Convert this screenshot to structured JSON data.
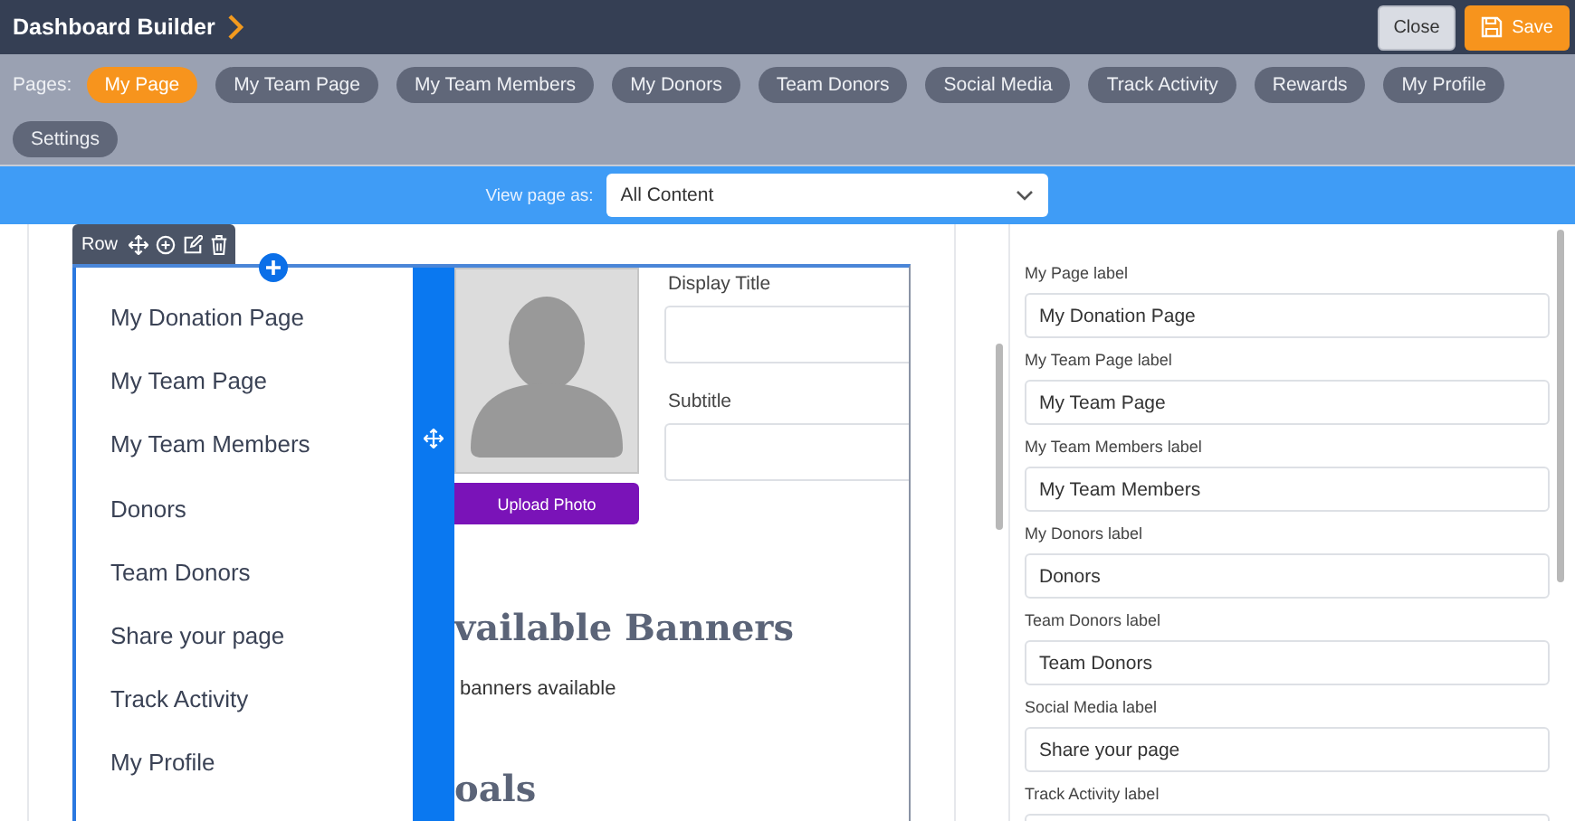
{
  "header": {
    "title": "Dashboard Builder",
    "buttons": [
      {
        "label": "Close",
        "kind": "plain"
      },
      {
        "label": "Save",
        "kind": "save"
      }
    ]
  },
  "pages": {
    "label": "Pages:",
    "items": [
      {
        "label": "My Page",
        "selected": true
      },
      {
        "label": "My Team Page",
        "selected": false
      },
      {
        "label": "My Team Members",
        "selected": false
      },
      {
        "label": "My Donors",
        "selected": false
      },
      {
        "label": "Team Donors",
        "selected": false
      },
      {
        "label": "Social Media",
        "selected": false
      },
      {
        "label": "Track Activity",
        "selected": false
      },
      {
        "label": "Rewards",
        "selected": false
      },
      {
        "label": "My Profile",
        "selected": false
      },
      {
        "label": "Settings",
        "selected": false
      }
    ]
  },
  "view_bar": {
    "label": "View page as:",
    "value": "All Content"
  },
  "canvas": {
    "row_toolbar": {
      "label": "Row"
    },
    "menu_items": [
      "My Donation Page",
      "My Team Page",
      "My Team Members",
      "Donors",
      "Team Donors",
      "Share your page",
      "Track Activity",
      "My Profile"
    ],
    "upload_button": "Upload Photo",
    "fields": [
      {
        "label": "Display Title"
      },
      {
        "label": "Subtitle"
      }
    ],
    "banners_heading": "vailable Banners",
    "banners_text": "banners available",
    "goals_heading": "oals"
  },
  "settings_panel": {
    "fields": [
      {
        "label": "My Page label",
        "value": "My Donation Page"
      },
      {
        "label": "My Team Page label",
        "value": "My Team Page"
      },
      {
        "label": "My Team Members label",
        "value": "My Team Members"
      },
      {
        "label": "My Donors label",
        "value": "Donors"
      },
      {
        "label": "Team Donors label",
        "value": "Team Donors"
      },
      {
        "label": "Social Media label",
        "value": "Share your page"
      },
      {
        "label": "Track Activity label"
      }
    ]
  }
}
